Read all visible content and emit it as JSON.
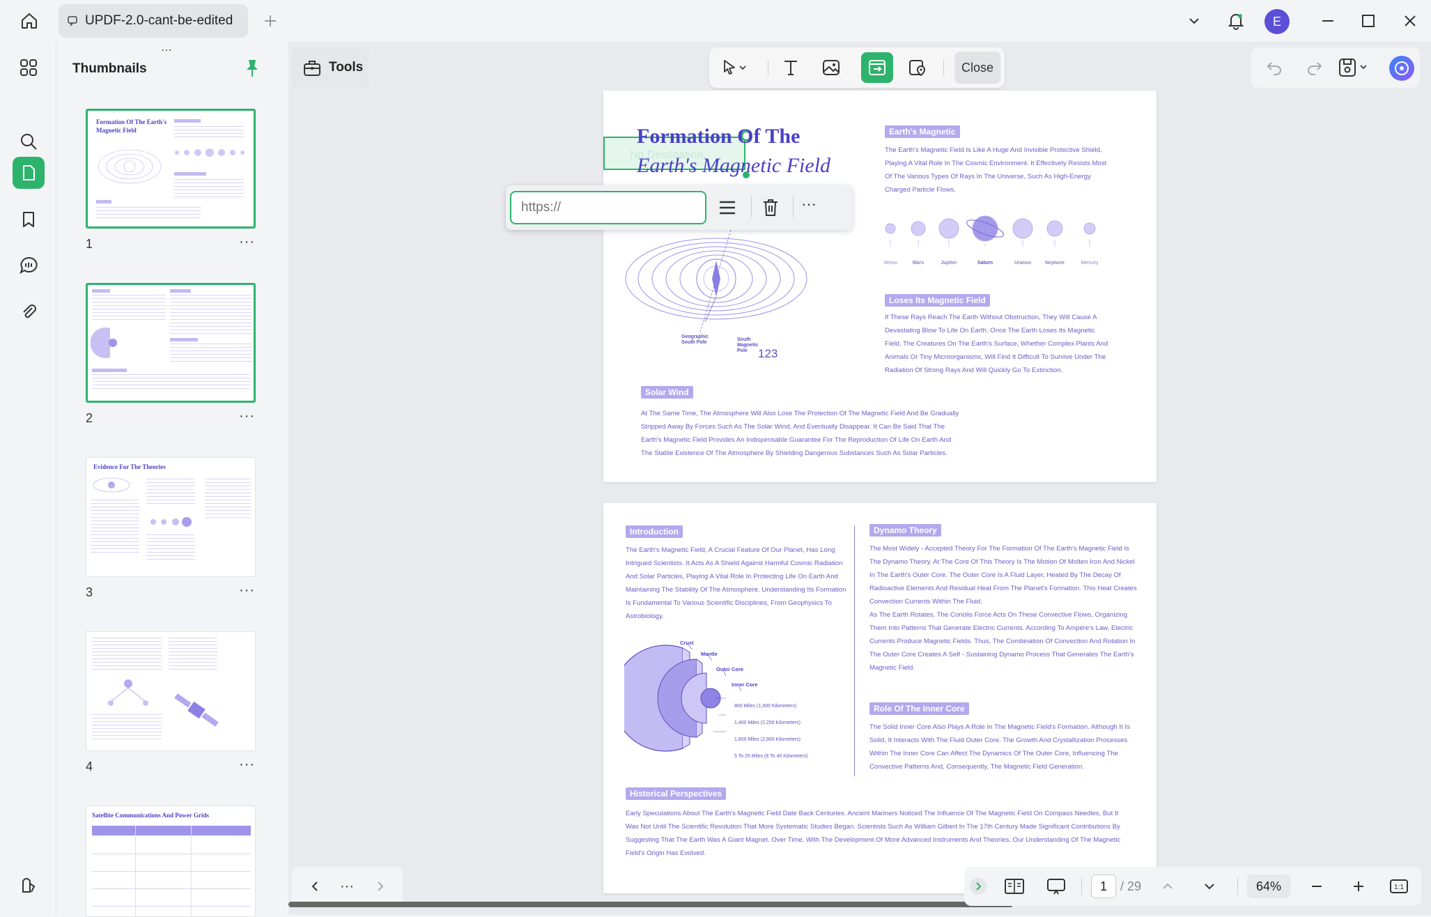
{
  "titlebar": {
    "tab_title": "UPDF-2.0-cant-be-edited",
    "avatar_letter": "E"
  },
  "sidebar": {
    "panel_title": "Thumbnails",
    "thumbnails": [
      {
        "number": "1",
        "title": "Formation Of The Earth's Magnetic Field"
      },
      {
        "number": "2",
        "title": ""
      },
      {
        "number": "3",
        "title": "Evidence For The Theories"
      },
      {
        "number": "4",
        "title": ""
      },
      {
        "number": "",
        "title": "Satellite Communications And Power Grids"
      }
    ]
  },
  "toolbar": {
    "tools_label": "Tools",
    "close_label": "Close"
  },
  "link_popup": {
    "url_placeholder": "https://"
  },
  "page1": {
    "title_line1": "Formation Of The",
    "title_line2": "Earth's Magnetic Field",
    "overlay_text": "No Destination",
    "earths_magnetic_tag": "Earth's Magnetic",
    "earths_magnetic_text": [
      "The Earth's Magnetic Field Is Like A Huge And Invisible Protective Shield,",
      "Playing A Vital Role In The Cosmic Environment. It Effectively Resists Most",
      "Of The Various Types Of Rays In The Universe, Such As High-Energy",
      "Charged Particle Flows."
    ],
    "planets": [
      "Venus",
      "Mars",
      "Jupiter",
      "Saturn",
      "Uranus",
      "Neptune",
      "Mercury"
    ],
    "loses_tag": "Loses Its Magnetic Field",
    "loses_text": [
      "If These Rays Reach The Earth Without Obstruction, They Will Cause A",
      "Devastating Blow To Life On Earth. Once The Earth Loses Its Magnetic",
      "Field, The Creatures On The Earth's Surface, Whether Complex Plants And",
      "Animals Or Tiny Microorganisms, Will Find It Difficult To Survive Under The",
      "Radiation Of Strong Rays And Will Quickly Go To Extinction."
    ],
    "geo_south_pole": "Geographic South Pole",
    "south_magnetic_pole": "South Magnetic Pole",
    "number_label": "123",
    "solar_wind_tag": "Solar Wind",
    "solar_wind_text": [
      "At The Same Time, The Atmosphere Will Also Lose The Protection Of The Magnetic Field And Be Gradually",
      "Stripped Away By Forces Such As The Solar Wind, And Eventually Disappear. It Can Be Said That The",
      "Earth's Magnetic Field Provides An Indispensable Guarantee For The Reproduction Of Life On Earth And",
      "The Stable Existence Of The Atmosphere By Shielding Dangerous Substances Such As Solar Particles."
    ]
  },
  "page2": {
    "intro_tag": "Introduction",
    "intro_text": [
      "The Earth's Magnetic Field, A Crucial Feature Of Our Planet, Has Long",
      "Intrigued Scientists. It Acts As A Shield Against Harmful Cosmic Radiation",
      "And Solar Particles, Playing A Vital Role In Protecting Life On Earth And",
      "Maintaining The Stability Of The Atmosphere. Understanding Its Formation",
      "Is Fundamental To Various Scientific Disciplines, From Geophysics To",
      "Astrobiology."
    ],
    "layers": [
      "Crust",
      "Mantle",
      "Outer Core",
      "Inner Core"
    ],
    "distances": [
      "800 Miles (1,300 Kilometers)",
      "1,400 Miles (2,250 Kilometers)",
      "1,800 Miles (2,900 Kilometers)",
      "5 To 25 Miles (8 To 40 Kilometers)"
    ],
    "dynamo_tag": "Dynamo Theory",
    "dynamo_text": [
      "The Most Widely - Accepted Theory For The Formation Of The Earth's Magnetic Field Is",
      "The Dynamo Theory. At The Core Of This Theory Is The Motion Of Molten Iron And Nickel",
      "In The Earth's Outer Core. The Outer Core Is A Fluid Layer, Heated By The Decay Of",
      "Radioactive Elements And Residual Heat From The Planet's Formation. This Heat Creates",
      "Convection Currents Within The Fluid.",
      "As The Earth Rotates, The Coriolis Force Acts On These Convective Flows, Organizing",
      "Them Into Patterns That Generate Electric Currents. According To Ampère's Law, Electric",
      "Currents Produce Magnetic Fields. Thus, The Combination Of Convection And Rotation In",
      "The Outer Core Creates A Self - Sustaining Dynamo Process That Generates The Earth's",
      "Magnetic Field."
    ],
    "inner_core_tag": "Role Of The Inner Core",
    "inner_core_text": [
      "The Solid Inner Core Also Plays A Role In The Magnetic Field's Formation. Although It Is",
      "Solid, It Interacts With The Fluid Outer Core. The Growth And Crystallization Processes",
      "Within The Inner Core Can Affect The Dynamics Of The Outer Core, Influencing The",
      "Convective Patterns And, Consequently, The Magnetic Field Generation."
    ],
    "historical_tag": "Historical Perspectives",
    "historical_text": [
      "Early Speculations About The Earth's Magnetic Field Date Back Centuries. Ancient Mariners Noticed The Influence Of The Magnetic Field On Compass Needles, But It",
      "Was Not Until The Scientific Revolution That More Systematic Studies Began. Scientists Such As William Gilbert In The 17th Century Made Significant Contributions By",
      "Suggesting That The Earth Was A Giant Magnet. Over Time, With The Development Of More Advanced Instruments And Theories, Our Understanding Of The Magnetic",
      "Field's Origin Has Evolved."
    ]
  },
  "nav": {
    "current_page": "1",
    "total_pages": "/ 29",
    "zoom": "64%"
  },
  "colors": {
    "accent": "#2db36c",
    "doc_purple": "#6a5ec4",
    "tag_purple": "#b3a9ee"
  }
}
